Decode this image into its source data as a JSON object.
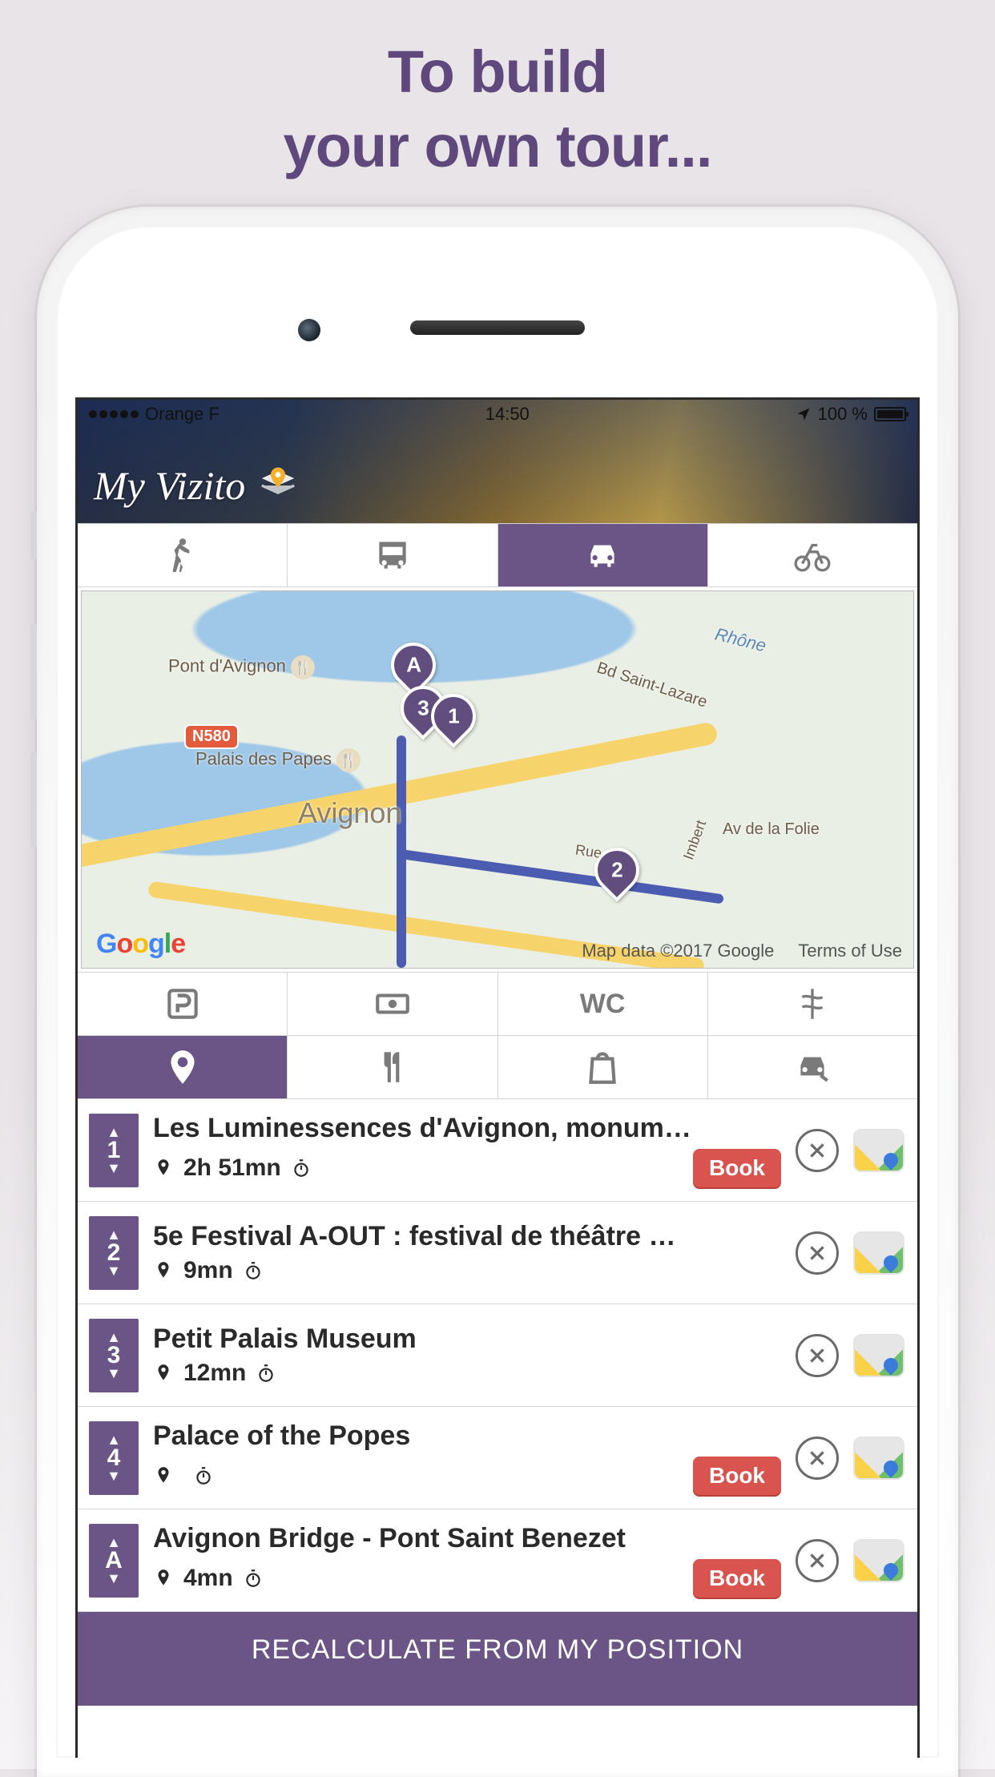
{
  "promo": {
    "line1": "To build",
    "line2": "your own tour..."
  },
  "status_bar": {
    "carrier": "Orange F",
    "time": "14:50",
    "battery_text": "100 %"
  },
  "app": {
    "name": "My Vizito"
  },
  "transport_tabs": {
    "items": [
      "walk",
      "bus",
      "car",
      "bike"
    ],
    "active_index": 2
  },
  "map": {
    "places": {
      "pont": "Pont d'Avignon",
      "palais": "Palais des Papes",
      "city": "Avignon",
      "river": "Rhône",
      "bd": "Bd Saint-Lazare",
      "av": "Av de la Folie",
      "rue": "Rue ...",
      "imbert": "Imbert"
    },
    "road_badge": "N580",
    "pins": [
      {
        "label": "A"
      },
      {
        "label": "3"
      },
      {
        "label": "1"
      },
      {
        "label": "2"
      }
    ],
    "attribution": "Map data ©2017 Google",
    "terms": "Terms of Use"
  },
  "amenity_tabs": {
    "row1": [
      "parking",
      "cash",
      "wc",
      "pharmacy"
    ],
    "row2": [
      "poi",
      "restaurant",
      "shopping",
      "car-service"
    ],
    "wc_label": "WC",
    "active": "poi"
  },
  "list": [
    {
      "order": "1",
      "title": "Les Luminessences d'Avignon, monum…",
      "duration": "2h 51mn",
      "has_book": true
    },
    {
      "order": "2",
      "title": "5e Festival A-OUT : festival de théâtre …",
      "duration": "9mn",
      "has_book": false
    },
    {
      "order": "3",
      "title": "Petit Palais Museum",
      "duration": "12mn",
      "has_book": false
    },
    {
      "order": "4",
      "title": "Palace of the Popes",
      "duration": "",
      "has_book": true
    },
    {
      "order": "A",
      "title": "Avignon Bridge - Pont Saint Benezet",
      "duration": "4mn",
      "has_book": true
    }
  ],
  "book_label": "Book",
  "recalc_label": "RECALCULATE FROM MY POSITION"
}
